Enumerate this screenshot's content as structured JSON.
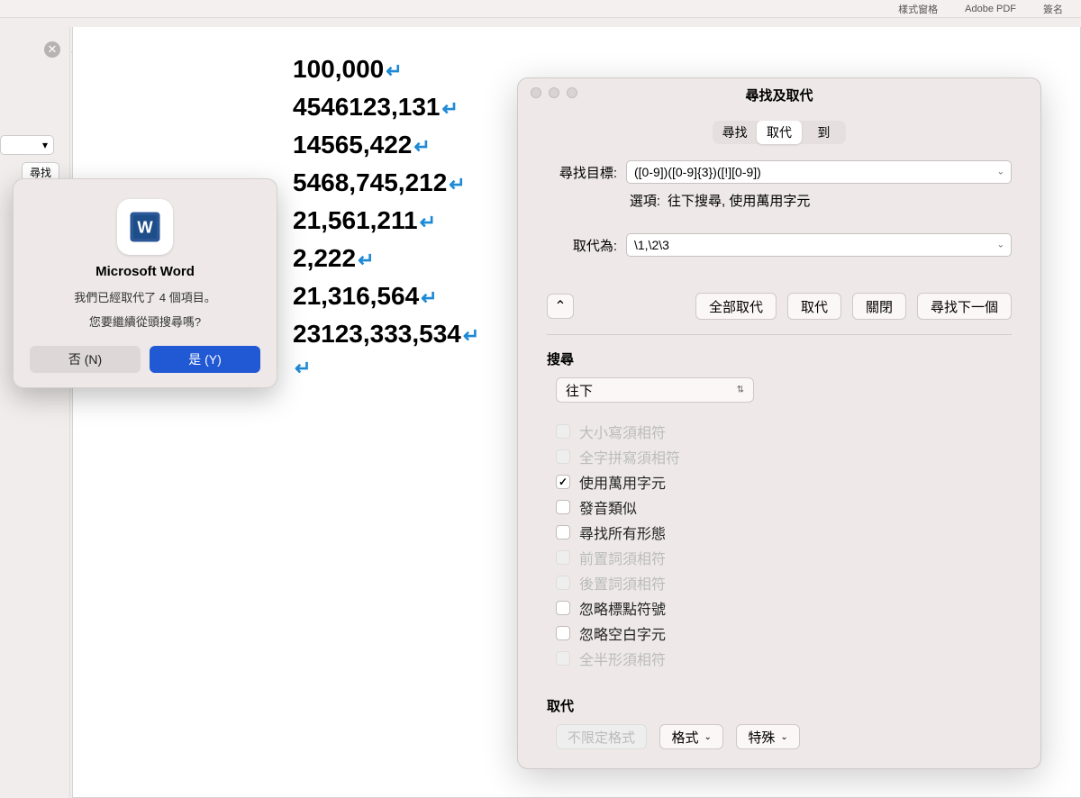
{
  "ribbon": {
    "labels": [
      "樣式窗格",
      "Adobe PDF",
      "簽名"
    ]
  },
  "leftPanel": {
    "searchLabel": "尋找"
  },
  "document": {
    "lines": [
      "100,000",
      "4546123,131",
      "14565,422",
      "5468,745,212",
      "21,561,211",
      "2,222",
      "21,316,564",
      "23123,333,534"
    ]
  },
  "alert": {
    "appName": "Microsoft Word",
    "message": "我們已經取代了 4 個項目。",
    "question": "您要繼續從頭搜尋嗎?",
    "noLabel": "否 (N)",
    "yesLabel": "是 (Y)"
  },
  "findReplace": {
    "title": "尋找及取代",
    "tabs": {
      "find": "尋找",
      "replace": "取代",
      "goto": "到"
    },
    "findLabel": "尋找目標:",
    "findValue": "([0-9])([0-9]{3})([!][0-9])",
    "optionsLabel": "選項:",
    "optionsValue": "往下搜尋, 使用萬用字元",
    "replaceLabel": "取代為:",
    "replaceValue": "\\1,\\2\\3",
    "buttons": {
      "replaceAll": "全部取代",
      "replace": "取代",
      "close": "關閉",
      "findNext": "尋找下一個"
    },
    "searchSection": "搜尋",
    "searchDirection": "往下",
    "checkboxes": [
      {
        "label": "大小寫須相符",
        "state": "disabled"
      },
      {
        "label": "全字拼寫須相符",
        "state": "disabled"
      },
      {
        "label": "使用萬用字元",
        "state": "checked"
      },
      {
        "label": "發音類似",
        "state": "unchecked"
      },
      {
        "label": "尋找所有形態",
        "state": "unchecked"
      },
      {
        "label": "前置詞須相符",
        "state": "disabled"
      },
      {
        "label": "後置詞須相符",
        "state": "disabled"
      },
      {
        "label": "忽略標點符號",
        "state": "unchecked"
      },
      {
        "label": "忽略空白字元",
        "state": "unchecked"
      },
      {
        "label": "全半形須相符",
        "state": "disabled"
      }
    ],
    "replaceSection": "取代",
    "noFormatLabel": "不限定格式",
    "formatLabel": "格式",
    "specialLabel": "特殊"
  }
}
